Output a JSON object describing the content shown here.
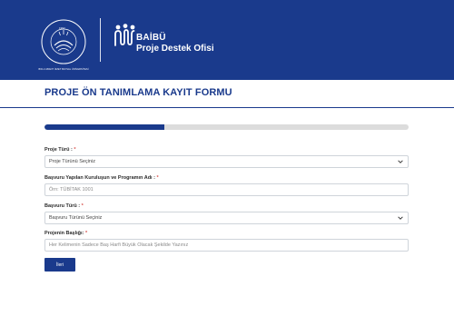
{
  "header": {
    "seal_text": "BOLU ABANT İZZET BAYSAL ÜNİVERSİTESİ",
    "seal_year": "1992",
    "brand": "BAİBÜ",
    "subtitle": "Proje Destek Ofisi",
    "background_color": "#1a3a8c"
  },
  "form": {
    "title": "PROJE ÖN TANIMLAMA KAYIT FORMU",
    "progress": 0.33,
    "fields": [
      {
        "label": "Proje Türü :",
        "required_mark": "*",
        "type": "select",
        "value": "Proje Türünü Seçiniz"
      },
      {
        "label": "Başvuru Yapılan Kuruluşun ve Programın Adı :",
        "required_mark": "*",
        "type": "text",
        "placeholder": "Örn: TÜBİTAK 1001"
      },
      {
        "label": "Başvuru Türü :",
        "required_mark": "*",
        "type": "select",
        "value": "Başvuru Türünü Seçiniz"
      },
      {
        "label": "Projenin Başlığı:",
        "required_mark": "*",
        "type": "text",
        "placeholder": "Her Kelimenin Sadece Baş Harfi Büyük Olacak Şekilde Yazınız"
      }
    ],
    "submit_label": "İleri"
  },
  "icons": {
    "seal": "university-seal-icon",
    "logo": "pdo-logo-icon",
    "select_arrow": "chevron-down-icon"
  },
  "colors": {
    "primary": "#1a3a8c",
    "track": "#dcdcdc",
    "required": "#d9534f"
  }
}
